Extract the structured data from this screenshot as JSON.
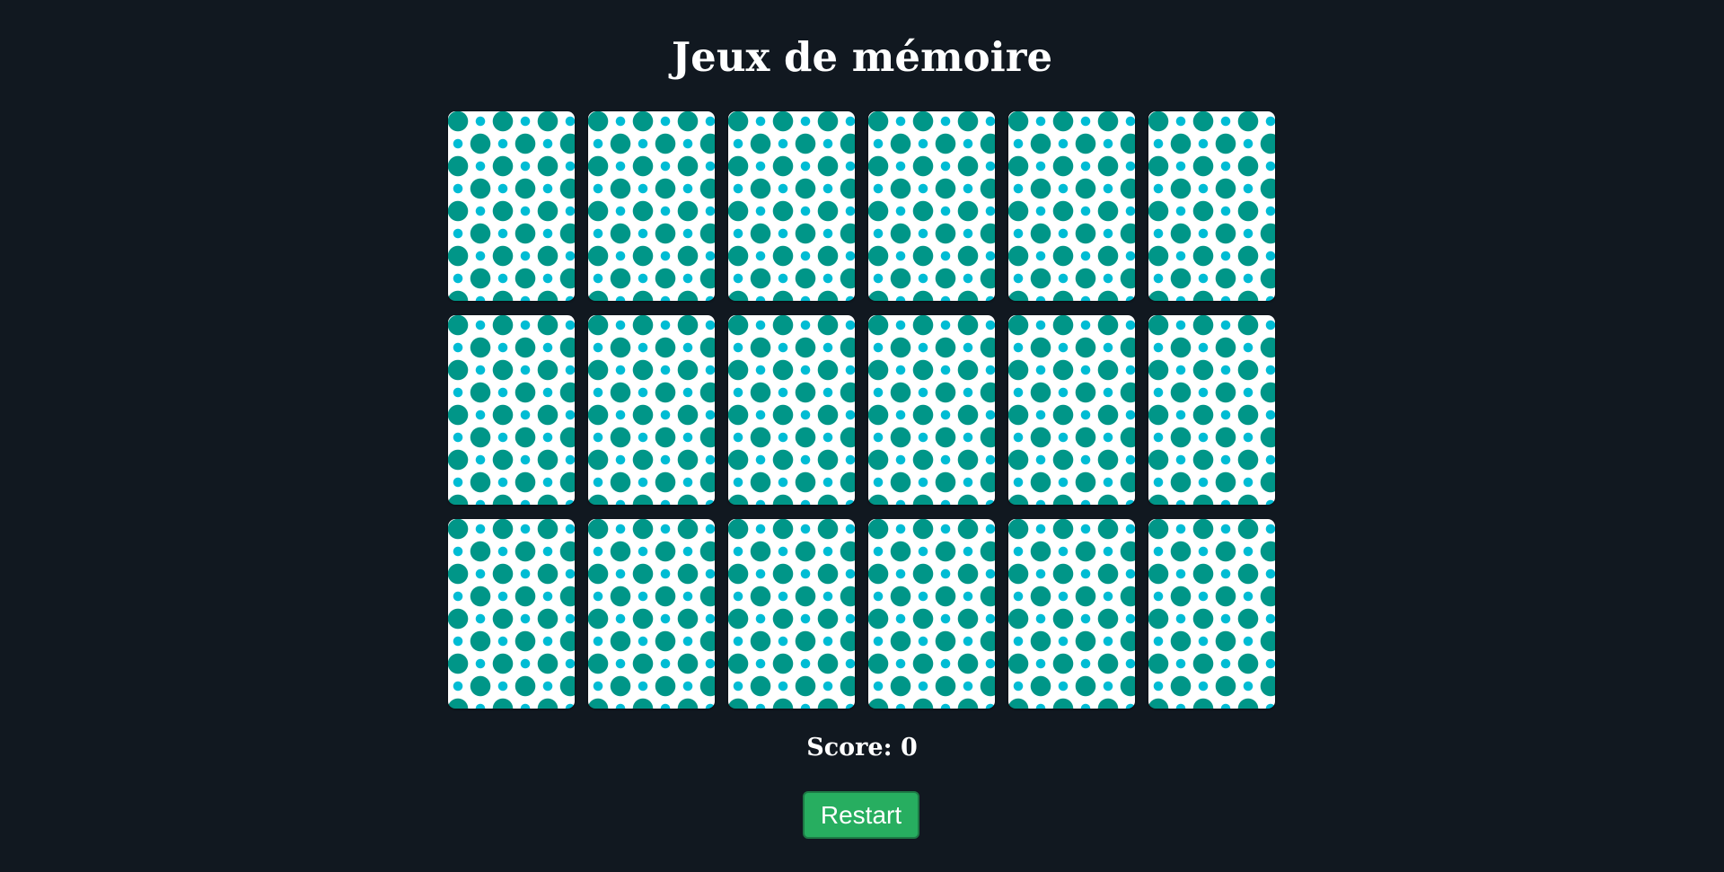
{
  "header": {
    "title": "Jeux de mémoire"
  },
  "board": {
    "rows": 3,
    "columns": 6,
    "cards": [
      {
        "state": "face-down"
      },
      {
        "state": "face-down"
      },
      {
        "state": "face-down"
      },
      {
        "state": "face-down"
      },
      {
        "state": "face-down"
      },
      {
        "state": "face-down"
      },
      {
        "state": "face-down"
      },
      {
        "state": "face-down"
      },
      {
        "state": "face-down"
      },
      {
        "state": "face-down"
      },
      {
        "state": "face-down"
      },
      {
        "state": "face-down"
      },
      {
        "state": "face-down"
      },
      {
        "state": "face-down"
      },
      {
        "state": "face-down"
      },
      {
        "state": "face-down"
      },
      {
        "state": "face-down"
      },
      {
        "state": "face-down"
      }
    ],
    "card_back_colors": {
      "base": "#ffffff",
      "large_dot": "#009688",
      "small_dot": "#00bcd4"
    }
  },
  "status": {
    "score_label": "Score: 0"
  },
  "controls": {
    "restart_label": "Restart"
  },
  "colors": {
    "background": "#111820",
    "button": "#27ae60",
    "text": "#ffffff"
  }
}
